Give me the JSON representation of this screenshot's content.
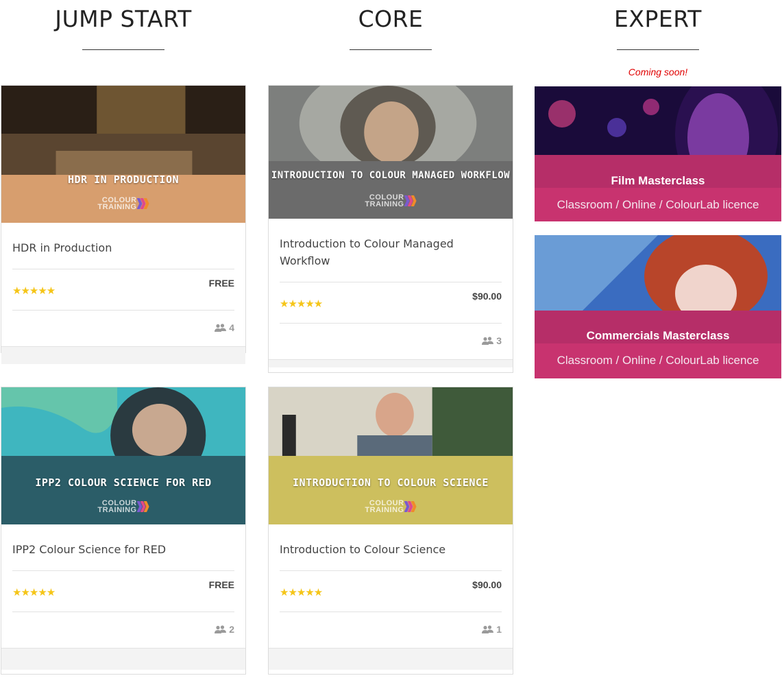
{
  "columns": [
    {
      "title": "JUMP START"
    },
    {
      "title": "CORE"
    },
    {
      "title": "EXPERT"
    }
  ],
  "expert_note": "Coming soon!",
  "courses": [
    {
      "banner": "HDR IN PRODUCTION",
      "title": "HDR in Production",
      "price": "FREE",
      "rating": 5,
      "students": "4"
    },
    {
      "banner": "INTRODUCTION TO COLOUR MANAGED WORKFLOW",
      "title": "Introduction to Colour Managed Workflow",
      "price": "$90.00",
      "rating": 5,
      "students": "3"
    },
    {
      "banner": "IPP2 COLOUR SCIENCE FOR RED",
      "title": "IPP2 Colour Science for RED",
      "price": "FREE",
      "rating": 5,
      "students": "2"
    },
    {
      "banner": "INTRODUCTION TO COLOUR SCIENCE",
      "title": "Introduction to Colour Science",
      "price": "$90.00",
      "rating": 5,
      "students": "1"
    }
  ],
  "logo": {
    "line1": "COLOUR",
    "line2": "TRAINING"
  },
  "stars_text": "★★★★★",
  "promos": [
    {
      "title": "Film Masterclass",
      "subtitle": "Classroom / Online / ColourLab licence"
    },
    {
      "title": "Commercials Masterclass",
      "subtitle": "Classroom / Online / ColourLab licence"
    }
  ],
  "colors": {
    "star": "#f5c518",
    "coming_soon": "#e00000",
    "promo_band": "#c8336f",
    "hdr_band": "#d79e6e",
    "cmw_band": "#6b6b6b",
    "ipp2_band": "#2b5d68",
    "ics_band": "#cdbf5e"
  },
  "icons": {
    "students": "users-icon",
    "rating": "star-icon",
    "logo_chevrons": "chevron-right-icon"
  }
}
